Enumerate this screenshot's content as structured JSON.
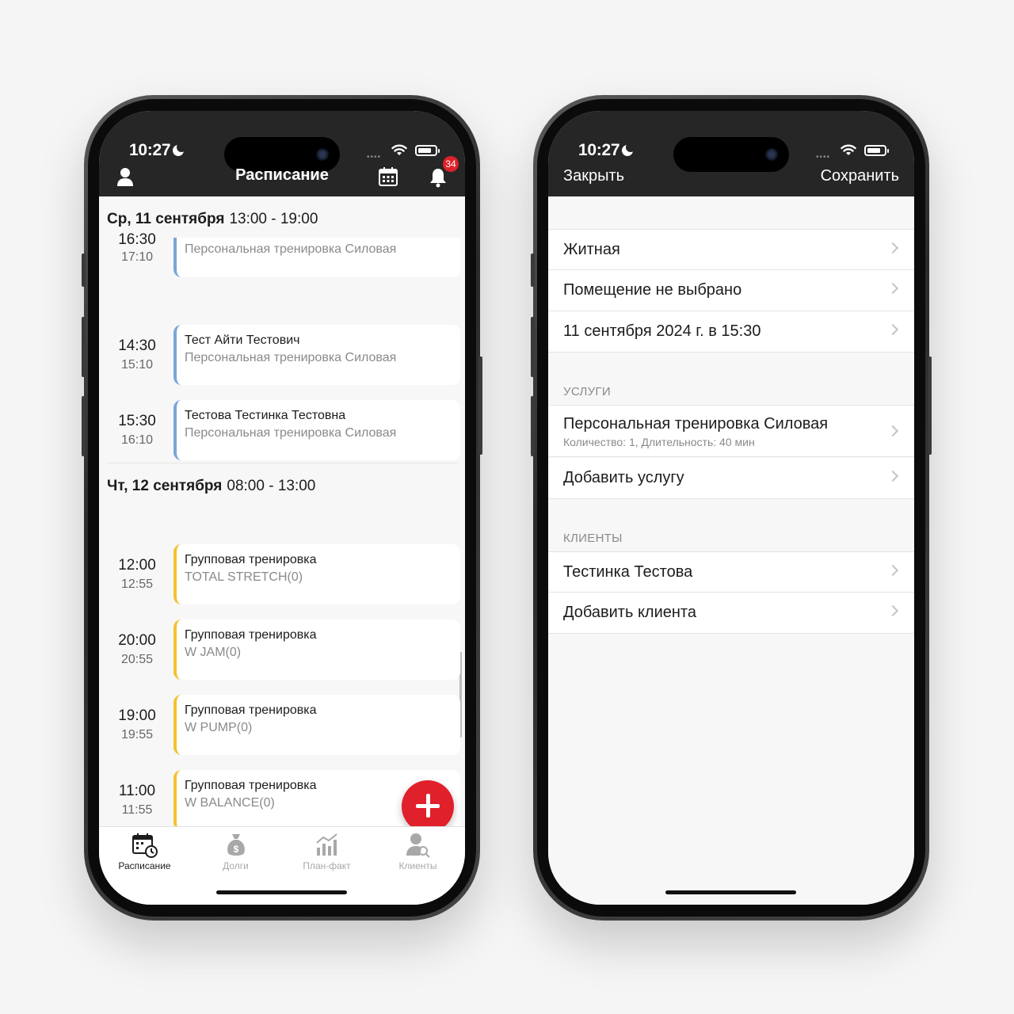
{
  "left_phone": {
    "status": {
      "time": "10:27"
    },
    "header": {
      "title": "Расписание",
      "notification_count": "34"
    },
    "days": [
      {
        "day": "Ср, 11 сентября",
        "hours": "13:00 - 19:00"
      },
      {
        "day": "Чт, 12 сентября",
        "hours": "08:00 - 13:00"
      }
    ],
    "partial_row": {
      "start": "16:30",
      "end": "17:10",
      "subtitle": "Персональная тренировка Силовая"
    },
    "rows": [
      {
        "start": "14:30",
        "end": "15:10",
        "title": "Тест Айти Тестович",
        "subtitle": "Персональная тренировка Силовая"
      },
      {
        "start": "15:30",
        "end": "16:10",
        "title": "Тестова Тестинка Тестовна",
        "subtitle": "Персональная тренировка Силовая"
      },
      {
        "start": "12:00",
        "end": "12:55",
        "title": "Групповая тренировка",
        "subtitle": "TOTAL STRETCH(0)"
      },
      {
        "start": "20:00",
        "end": "20:55",
        "title": "Групповая тренировка",
        "subtitle": "W JAM(0)"
      },
      {
        "start": "19:00",
        "end": "19:55",
        "title": "Групповая тренировка",
        "subtitle": "W PUMP(0)"
      },
      {
        "start": "11:00",
        "end": "11:55",
        "title": "Групповая тренировка",
        "subtitle": "W BALANCE(0)"
      }
    ],
    "tabs": [
      {
        "label": "Расписание",
        "icon": "calendar-clock-icon"
      },
      {
        "label": "Долги",
        "icon": "money-bag-icon"
      },
      {
        "label": "План-факт",
        "icon": "bar-chart-icon"
      },
      {
        "label": "Клиенты",
        "icon": "user-search-icon"
      }
    ],
    "colors": {
      "personal": "#7aa6d8",
      "group": "#f2c230",
      "accent": "#e0202a"
    }
  },
  "right_phone": {
    "status": {
      "time": "10:27"
    },
    "nav": {
      "close_label": "Закрыть",
      "save_label": "Сохранить"
    },
    "details": [
      {
        "label": "Житная"
      },
      {
        "label": "Помещение не выбрано"
      },
      {
        "label": "11 сентября 2024 г. в 15:30"
      }
    ],
    "services_header": "УСЛУГИ",
    "service": {
      "name": "Персональная тренировка Силовая",
      "meta": "Количество: 1, Длительность: 40 мин"
    },
    "add_service_label": "Добавить услугу",
    "clients_header": "КЛИЕНТЫ",
    "client": {
      "name": "Тестинка Тестова"
    },
    "add_client_label": "Добавить клиента"
  }
}
